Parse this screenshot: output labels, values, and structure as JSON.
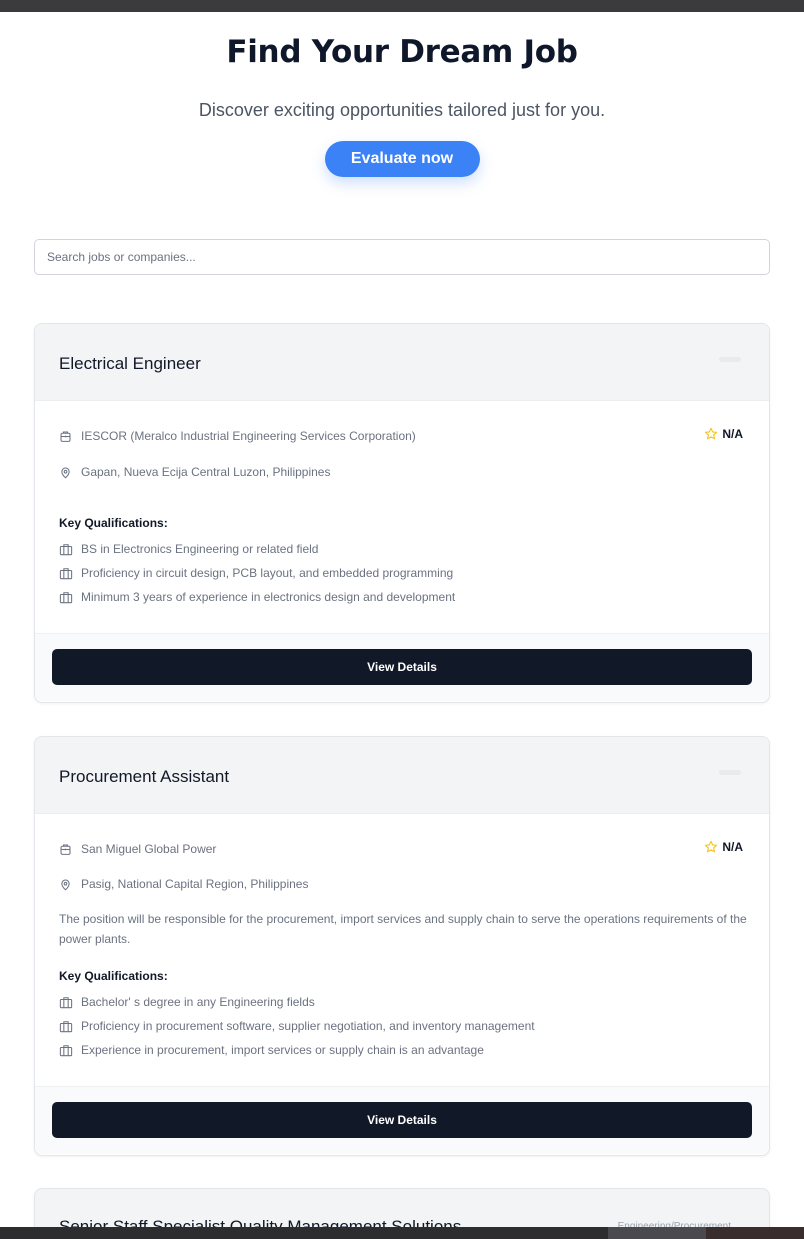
{
  "hero": {
    "title": "Find Your Dream Job",
    "subtitle": "Discover exciting opportunities tailored just for you.",
    "evaluate_label": "Evaluate now"
  },
  "search": {
    "placeholder": "Search jobs or companies...",
    "value": ""
  },
  "jobs": [
    {
      "title": "Electrical Engineer",
      "company": "IESCOR (Meralco Industrial Engineering Services Corporation)",
      "location": "Gapan, Nueva Ecija Central Luzon, Philippines",
      "rating": "N/A",
      "description": "",
      "qualifications_label": "Key Qualifications:",
      "qualifications": [
        "BS in Electronics Engineering or related field",
        "Proficiency in circuit design, PCB layout, and embedded programming",
        "Minimum 3 years of experience in electronics design and development"
      ],
      "button_label": "View Details"
    },
    {
      "title": "Procurement Assistant",
      "company": "San Miguel Global Power",
      "location": "Pasig, National Capital Region, Philippines",
      "rating": "N/A",
      "description": "The position will be responsible for the procurement, import services and supply chain to serve the operations requirements of the power plants.",
      "qualifications_label": "Key Qualifications:",
      "qualifications": [
        "Bachelor' s degree in any Engineering fields",
        "Proficiency in procurement software, supplier negotiation, and inventory management",
        "Experience in procurement, import services or supply chain is an advantage"
      ],
      "button_label": "View Details"
    },
    {
      "title": "Senior Staff Specialist Quality Management Solutions",
      "category": "Engineering/Procurement"
    }
  ],
  "colors": {
    "accent": "#3b82f6",
    "button_dark": "#111827",
    "star": "#f5c518"
  },
  "icons": {
    "company": "building-icon",
    "location": "map-pin-icon",
    "rating": "star-icon",
    "qualification": "briefcase-icon"
  }
}
